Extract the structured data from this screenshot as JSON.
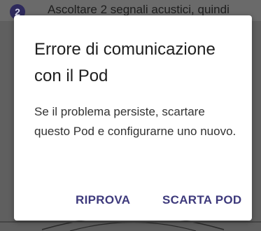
{
  "background": {
    "step_number": "2",
    "step_text": "Ascoltare 2 segnali acustici, quindi"
  },
  "dialog": {
    "title": "Errore di comunicazione con il Pod",
    "message": "Se il problema persiste, scartare questo Pod e configurarne uno nuovo.",
    "retry_label": "RIPROVA",
    "discard_label": "SCARTA POD"
  },
  "colors": {
    "accent": "#3e3a7c",
    "scrim": "#5f5f5f"
  }
}
